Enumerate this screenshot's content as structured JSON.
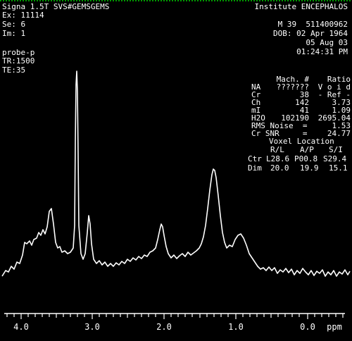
{
  "header_left": {
    "scanner": "Signa 1.5T SVS#GEMSGEMS",
    "exam": "Ex: 11114",
    "series": "Se: 6",
    "image": "Im: 1",
    "probe": "probe-p",
    "tr": "TR:1500",
    "te": "TE:35"
  },
  "header_right": {
    "institute": "Institute ENCEPHALOS",
    "patient": "M 39  511400962",
    "dob": "DOB: 02 Apr 1964",
    "date": "05 Aug 03",
    "time": "01:24:31 PM"
  },
  "metabolite_table": {
    "headers": [
      "",
      "Mach. #",
      "Ratio"
    ],
    "rows": [
      {
        "name": "NA",
        "value": "???????",
        "ratio": "V o i d"
      },
      {
        "name": "Cr",
        "value": "38",
        "ratio": "- Ref -"
      },
      {
        "name": "Ch",
        "value": "142",
        "ratio": "3.73"
      },
      {
        "name": "mI",
        "value": "41",
        "ratio": "1.09"
      },
      {
        "name": "H2O",
        "value": "102190",
        "ratio": "2695.04"
      }
    ],
    "rms_noise_label": "RMS Noise  =",
    "rms_noise_value": "1.53",
    "cr_snr_label": "Cr SNR     =",
    "cr_snr_value": "24.77"
  },
  "voxel": {
    "title": "Voxel Location",
    "columns": [
      "R/L",
      "A/P",
      "S/I"
    ],
    "ctr_label": "Ctr",
    "ctr_values": [
      "L28.6",
      "P00.8",
      "S29.4"
    ],
    "dim_label": "Dim",
    "dim_values": [
      "20.0",
      "19.9",
      "15.1"
    ]
  },
  "axis": {
    "ticks": [
      "4.0",
      "3.0",
      "2.0",
      "1.0",
      "0.0"
    ],
    "unit": "ppm"
  },
  "colors": {
    "background": "#000000",
    "foreground": "#ffffff",
    "top_bar": "#00cc00"
  }
}
